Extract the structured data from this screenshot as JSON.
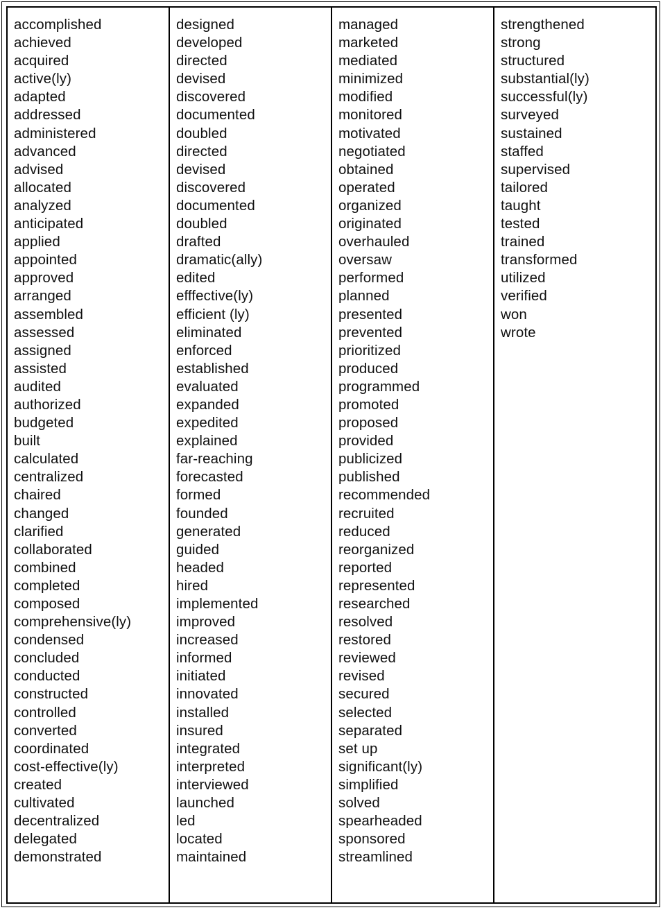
{
  "word_list": {
    "columns": [
      {
        "words": [
          "accomplished",
          "achieved",
          "acquired",
          "active(ly)",
          "adapted",
          "addressed",
          "administered",
          "advanced",
          "advised",
          "allocated",
          "analyzed",
          "anticipated",
          "applied",
          "appointed",
          "approved",
          "arranged",
          "assembled",
          "assessed",
          "assigned",
          "assisted",
          "audited",
          "authorized",
          "budgeted",
          "built",
          "calculated",
          "centralized",
          "chaired",
          "changed",
          "clarified",
          "collaborated",
          "combined",
          "completed",
          "composed",
          "comprehensive(ly)",
          "condensed",
          "concluded",
          "conducted",
          "constructed",
          "controlled",
          "converted",
          "coordinated",
          "cost-effective(ly)",
          "created",
          "cultivated",
          "decentralized",
          "delegated",
          "demonstrated"
        ]
      },
      {
        "words": [
          "designed",
          "developed",
          "directed",
          "devised",
          "discovered",
          "documented",
          "doubled",
          "directed",
          "devised",
          "discovered",
          "documented",
          "doubled",
          "drafted",
          "dramatic(ally)",
          "edited",
          "efffective(ly)",
          "efficient (ly)",
          "eliminated",
          "enforced",
          "established",
          "evaluated",
          "expanded",
          "expedited",
          "explained",
          "far-reaching",
          "forecasted",
          "formed",
          "founded",
          "generated",
          "guided",
          "headed",
          "hired",
          "implemented",
          "improved",
          "increased",
          "informed",
          "initiated",
          "innovated",
          "installed",
          "insured",
          "integrated",
          "interpreted",
          "interviewed",
          "launched",
          "led",
          "located",
          "maintained"
        ]
      },
      {
        "words": [
          "managed",
          "marketed",
          "mediated",
          "minimized",
          "modified",
          "monitored",
          "motivated",
          "negotiated",
          "obtained",
          "operated",
          "organized",
          "originated",
          "overhauled",
          "oversaw",
          "performed",
          "planned",
          "presented",
          "prevented",
          "prioritized",
          "produced",
          "programmed",
          "promoted",
          "proposed",
          "provided",
          "publicized",
          "published",
          "recommended",
          "recruited",
          "reduced",
          "reorganized",
          "reported",
          "represented",
          "researched",
          "resolved",
          "restored",
          "reviewed",
          "revised",
          "secured",
          "selected",
          "separated",
          "set up",
          "significant(ly)",
          "simplified",
          "solved",
          "spearheaded",
          "sponsored",
          "streamlined"
        ]
      },
      {
        "words": [
          "strengthened",
          "strong",
          "structured",
          "substantial(ly)",
          "successful(ly)",
          "surveyed",
          "sustained",
          "staffed",
          "supervised",
          "tailored",
          "taught",
          "tested",
          "trained",
          "transformed",
          "utilized",
          "verified",
          "won",
          "wrote"
        ]
      }
    ]
  }
}
